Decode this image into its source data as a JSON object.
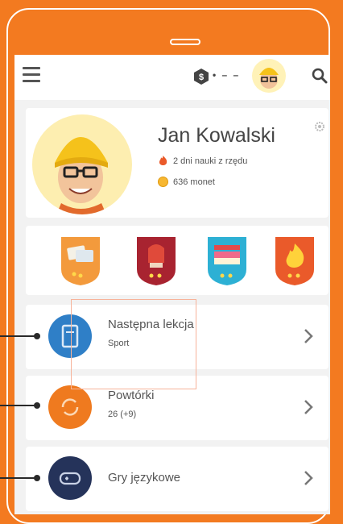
{
  "header": {
    "coin_count": "• – –"
  },
  "profile": {
    "name": "Jan Kowalski",
    "streak_text": "2 dni nauki z rzędu",
    "coins_text": "636 monet"
  },
  "badges": [
    {
      "icon": "cards-badge-icon",
      "color": "#f39a3c"
    },
    {
      "icon": "glove-badge-icon",
      "color": "#a82330"
    },
    {
      "icon": "cake-badge-icon",
      "color": "#2db0d4"
    },
    {
      "icon": "fire-badge-icon",
      "color": "#ea5a2a"
    }
  ],
  "rows": [
    {
      "title": "Następna lekcja",
      "subtitle": "Sport",
      "icon": "book-icon",
      "color": "#2f7fc7"
    },
    {
      "title": "Powtórki",
      "subtitle": "26 (+9)",
      "icon": "refresh-icon",
      "color": "#ef7a1f"
    },
    {
      "title": "Gry językowe",
      "subtitle": "",
      "icon": "gamepad-icon",
      "color": "#25335a"
    }
  ],
  "colors": {
    "brand": "#f37a20",
    "screen_bg": "#f2f2f2"
  }
}
